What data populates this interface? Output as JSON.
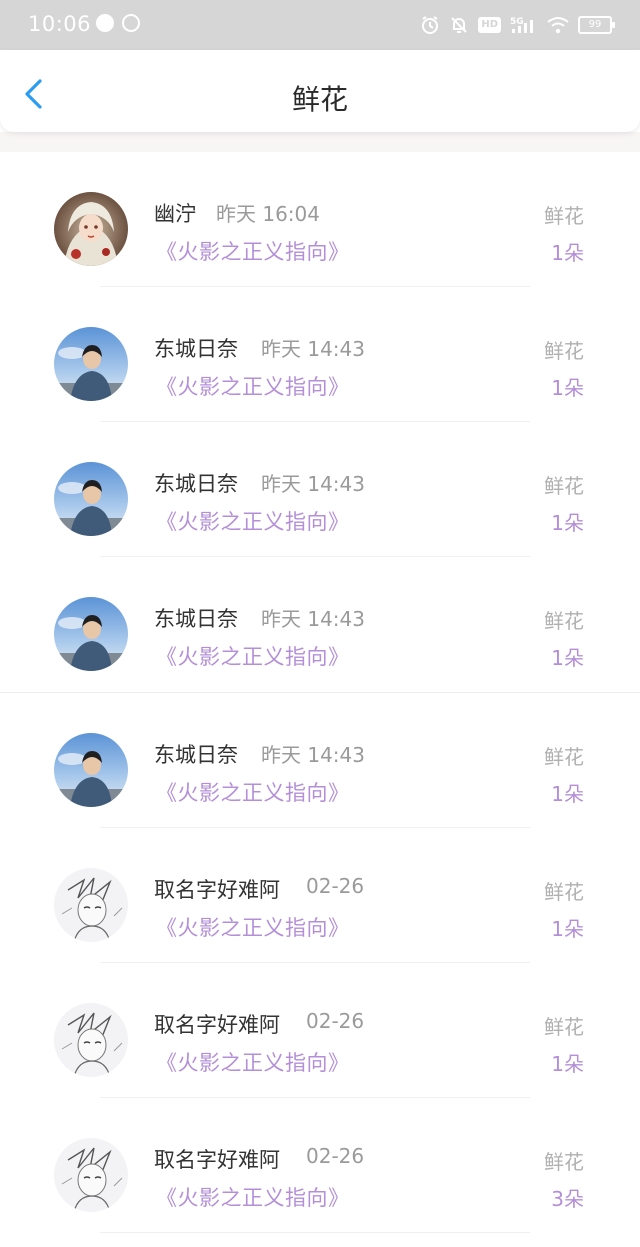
{
  "status_bar": {
    "time": "10:06",
    "network": "5G",
    "hd_label": "HD",
    "battery": "99"
  },
  "header": {
    "title": "鲜花"
  },
  "records": [
    {
      "name": "幽泞",
      "time": "昨天 16:04",
      "book": "《火影之正义指向》",
      "gift": "鲜花",
      "count": "1朵",
      "avatar": "avatar-girl"
    },
    {
      "name": "东城日奈",
      "time": "昨天 14:43",
      "book": "《火影之正义指向》",
      "gift": "鲜花",
      "count": "1朵",
      "avatar": "avatar-boy"
    },
    {
      "name": "东城日奈",
      "time": "昨天 14:43",
      "book": "《火影之正义指向》",
      "gift": "鲜花",
      "count": "1朵",
      "avatar": "avatar-boy"
    },
    {
      "name": "东城日奈",
      "time": "昨天 14:43",
      "book": "《火影之正义指向》",
      "gift": "鲜花",
      "count": "1朵",
      "avatar": "avatar-boy"
    },
    {
      "name": "东城日奈",
      "time": "昨天 14:43",
      "book": "《火影之正义指向》",
      "gift": "鲜花",
      "count": "1朵",
      "avatar": "avatar-boy"
    },
    {
      "name": "取名字好难阿",
      "time": "02-26",
      "book": "《火影之正义指向》",
      "gift": "鲜花",
      "count": "1朵",
      "avatar": "avatar-sketch"
    },
    {
      "name": "取名字好难阿",
      "time": "02-26",
      "book": "《火影之正义指向》",
      "gift": "鲜花",
      "count": "1朵",
      "avatar": "avatar-sketch"
    },
    {
      "name": "取名字好难阿",
      "time": "02-26",
      "book": "《火影之正义指向》",
      "gift": "鲜花",
      "count": "3朵",
      "avatar": "avatar-sketch"
    }
  ],
  "colors": {
    "accent_purple": "#b48fd8",
    "back_blue": "#2b9cf0",
    "status_bar_bg": "#d6d6d6"
  }
}
